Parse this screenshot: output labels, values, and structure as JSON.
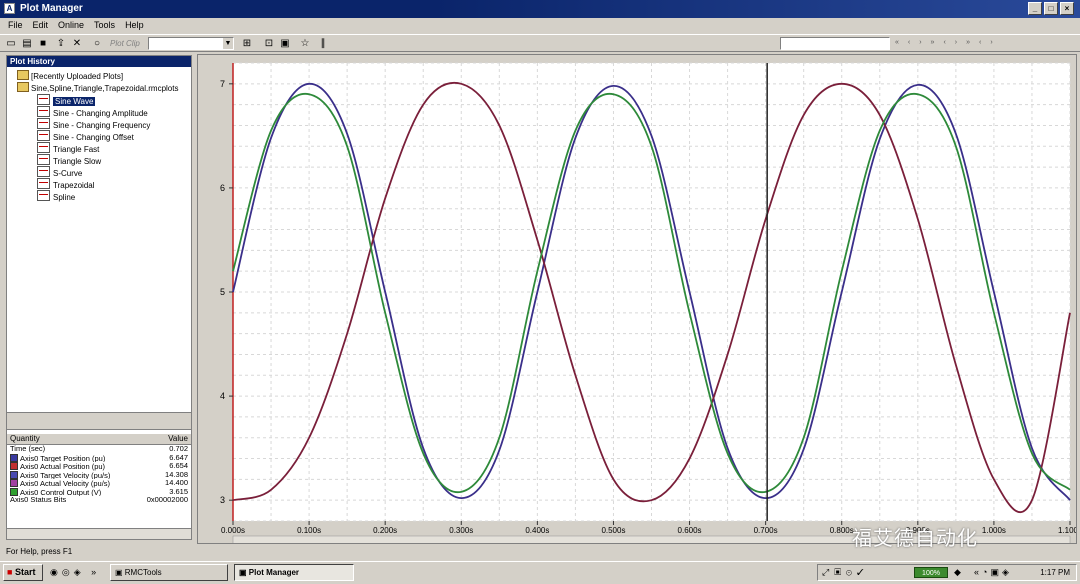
{
  "window": {
    "title": "Plot Manager",
    "icon": "app-icon"
  },
  "menu": [
    "File",
    "Edit",
    "Online",
    "Tools",
    "Help"
  ],
  "toolbar": {
    "plot_clip_placeholder": "Plot Clip"
  },
  "plot_history": {
    "header": "Plot History",
    "root_items": [
      "[Recently Uploaded Plots]",
      "Sine,Spline,Triangle,Trapezoidal.rmcplots"
    ],
    "plots": [
      "Sine Wave",
      "Sine - Changing Amplitude",
      "Sine - Changing Frequency",
      "Sine - Changing Offset",
      "Triangle Fast",
      "Triangle Slow",
      "S-Curve",
      "Trapezoidal",
      "Spline"
    ],
    "selected": "Sine Wave"
  },
  "quantity_table": {
    "header_quantity": "Quantity",
    "header_value": "Value",
    "rows": [
      {
        "name": "Time (sec)",
        "value": "0.702",
        "color": ""
      },
      {
        "name": "Axis0 Target Position (pu)",
        "value": "6.647",
        "color": "#3a3aa0"
      },
      {
        "name": "Axis0 Actual Position (pu)",
        "value": "6.654",
        "color": "#c03030"
      },
      {
        "name": "Axis0 Target Velocity (pu/s)",
        "value": "14.308",
        "color": "#4a4ab0"
      },
      {
        "name": "Axis0 Actual Velocity (pu/s)",
        "value": "14.400",
        "color": "#a040a0"
      },
      {
        "name": "Axis0 Control Output (V)",
        "value": "3.615",
        "color": "#30a030"
      },
      {
        "name": "Axis0 Status Bits",
        "value": "0x00002000",
        "color": ""
      }
    ]
  },
  "chart_data": {
    "type": "line",
    "xlim": [
      0,
      1.1
    ],
    "ylim": [
      2.8,
      7.2
    ],
    "y_ticks": [
      "3",
      "4",
      "5",
      "6",
      "7"
    ],
    "x_ticks": [
      "0.000s",
      "0.100s",
      "0.200s",
      "0.300s",
      "0.400s",
      "0.500s",
      "0.600s",
      "0.700s",
      "0.800s",
      "0.900s",
      "1.000s",
      "1.100s"
    ],
    "cursor_x": 0.702,
    "grid": true,
    "series": [
      {
        "color": "#3a2f8a",
        "x": [
          0,
          0.05,
          0.1,
          0.15,
          0.2,
          0.25,
          0.3,
          0.35,
          0.4,
          0.45,
          0.5,
          0.55,
          0.6,
          0.65,
          0.7,
          0.75,
          0.8,
          0.85,
          0.9,
          0.95,
          1.0,
          1.05,
          1.1
        ],
        "y": [
          5.0,
          6.48,
          7.0,
          6.52,
          5.0,
          3.5,
          3.02,
          3.48,
          5.0,
          6.48,
          6.98,
          6.5,
          5.0,
          3.5,
          3.02,
          3.49,
          5.0,
          6.47,
          6.99,
          6.52,
          5.0,
          3.5,
          3.0
        ]
      },
      {
        "color": "#7a1f3a",
        "x": [
          0,
          0.05,
          0.1,
          0.15,
          0.2,
          0.25,
          0.3,
          0.35,
          0.4,
          0.45,
          0.5,
          0.55,
          0.6,
          0.65,
          0.7,
          0.75,
          0.8,
          0.85,
          0.9,
          0.95,
          1.0,
          1.05,
          1.1
        ],
        "y": [
          3.0,
          3.1,
          3.6,
          4.6,
          5.9,
          6.8,
          7.0,
          6.6,
          5.5,
          4.2,
          3.2,
          3.0,
          3.4,
          4.4,
          5.7,
          6.7,
          7.0,
          6.7,
          5.7,
          4.3,
          3.2,
          3.0,
          4.8
        ]
      },
      {
        "color": "#2e8a3a",
        "x": [
          0,
          0.05,
          0.1,
          0.15,
          0.2,
          0.25,
          0.3,
          0.35,
          0.4,
          0.45,
          0.5,
          0.55,
          0.6,
          0.65,
          0.7,
          0.75,
          0.8,
          0.85,
          0.9,
          0.95,
          1.0,
          1.05,
          1.1
        ],
        "y": [
          5.2,
          6.55,
          6.9,
          6.4,
          4.8,
          3.45,
          3.08,
          3.6,
          5.2,
          6.55,
          6.9,
          6.4,
          4.8,
          3.45,
          3.08,
          3.6,
          5.2,
          6.55,
          6.9,
          6.4,
          4.8,
          3.45,
          3.1
        ]
      }
    ]
  },
  "status": {
    "help_text": "For Help, press F1"
  },
  "taskbar": {
    "start": "Start",
    "tasks": [
      "RMCTools",
      "Plot Manager"
    ],
    "battery": "100%",
    "clock": "1:17 PM"
  },
  "watermark": "福艾德自动化"
}
